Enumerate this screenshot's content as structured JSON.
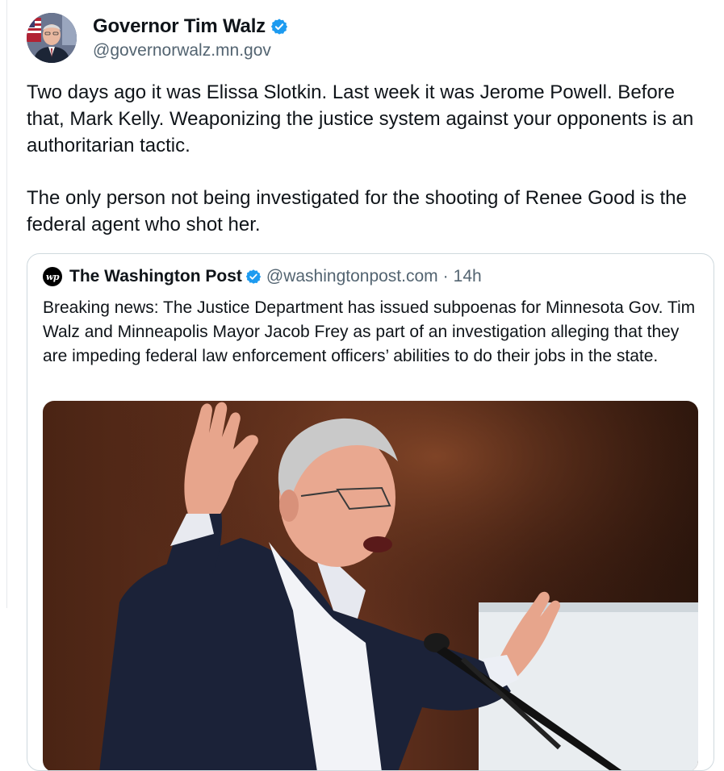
{
  "author": {
    "display_name": "Governor Tim Walz",
    "handle": "@governorwalz.mn.gov",
    "avatar": "governor-portrait-avatar",
    "verified_icon": "verified-badge-icon",
    "verified_color": "#1d9bf0"
  },
  "post": {
    "paragraph_1": "Two days ago it was Elissa Slotkin. Last week it was Jerome Powell. Before that, Mark Kelly. Weaponizing the justice system against your opponents is an authoritarian tactic.",
    "paragraph_2": "The only person not being investigated for the shooting of Renee Good is the federal agent who shot her."
  },
  "quoted_post": {
    "logo_icon": "washington-post-logo-icon",
    "logo_text": "wp",
    "display_name": "The Washington Post",
    "handle": "@washingtonpost.com",
    "separator": "·",
    "time": "14h",
    "text": "Breaking news: The Justice Department has issued subpoenas for Minnesota Gov. Tim Walz and Minneapolis Mayor Jacob Frey as part of an investigation alleging that they are impeding federal law enforcement officers’ abilities to do their jobs in the state.",
    "image": "photo-of-speaker-at-microphone"
  },
  "colors": {
    "text_primary": "#0f1419",
    "text_secondary": "#536471",
    "border": "#cfd9de",
    "accent": "#1d9bf0"
  }
}
